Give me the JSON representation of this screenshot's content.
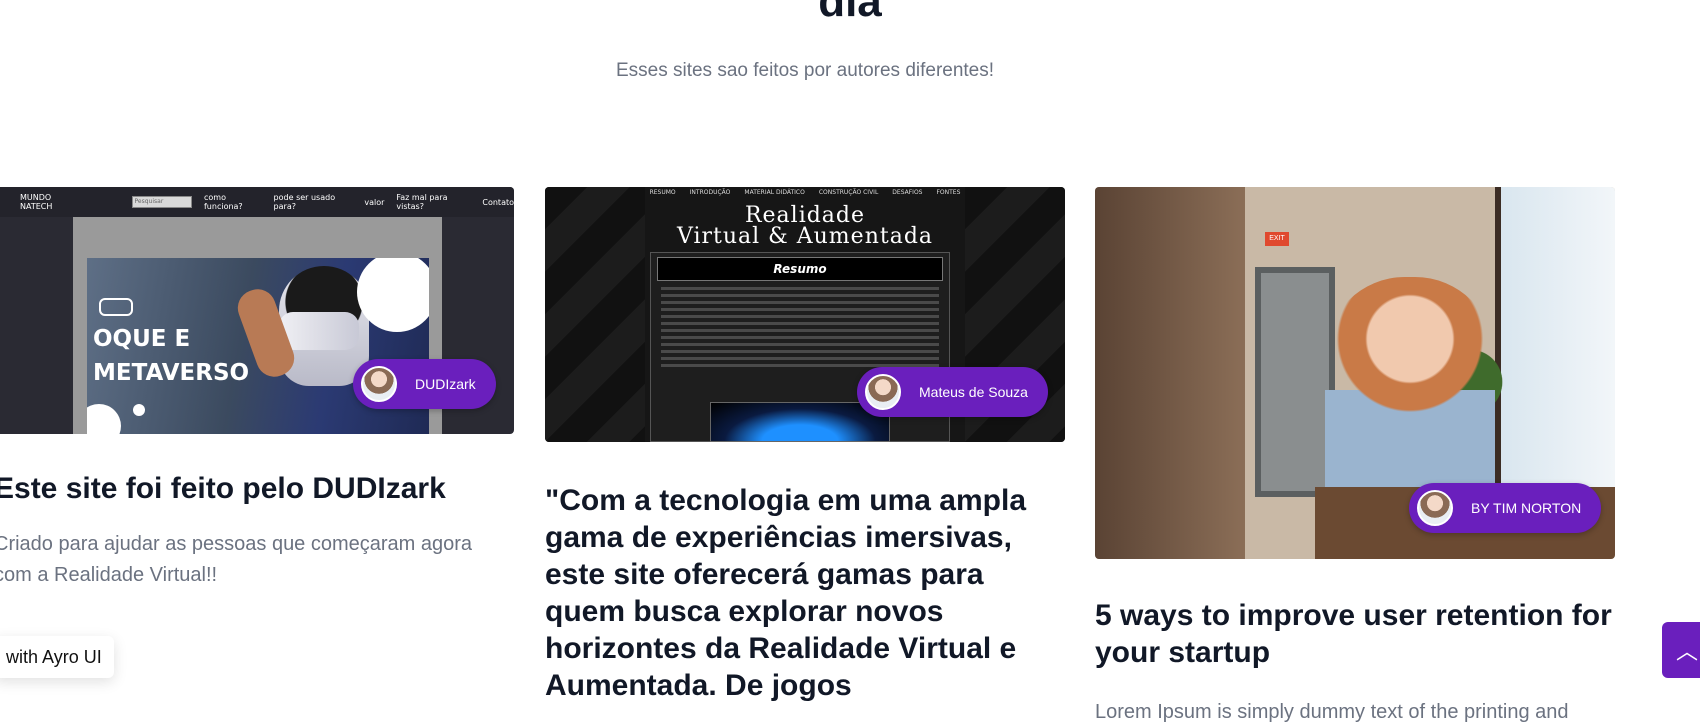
{
  "section": {
    "title": "dia",
    "subtitle": "Esses sites sao feitos por autores diferentes!"
  },
  "cards": [
    {
      "author": "DUDIzark",
      "title": "Este site foi feito pelo DUDIzark",
      "text": "Criado para ajudar as pessoas que começaram agora com a Realidade Virtual!!",
      "preview": {
        "nav_brand": "MUNDO NATECH",
        "search_placeholder": "Pesquisar",
        "nav_links": [
          "como funciona?",
          "pode ser usado para?",
          "valor",
          "Faz mal para vistas?",
          "Contato"
        ],
        "hero_text_line1": "OQUE E",
        "hero_text_line2": "METAVERSO"
      }
    },
    {
      "author": "Mateus de Souza",
      "title": "\"Com a tecnologia em uma ampla gama de experiências imersivas, este site oferecerá gamas para quem busca explorar novos horizontes da Realidade Virtual e Aumentada. De jogos",
      "preview": {
        "nav_links": [
          "RESUMO",
          "INTRODUÇÃO",
          "MATERIAL DIDÁTICO",
          "CONSTRUÇÃO CIVIL",
          "DESAFIOS",
          "FONTES"
        ],
        "title_line1": "Realidade",
        "title_line2": "Virtual & Aumentada",
        "box_heading": "Resumo"
      }
    },
    {
      "author": "BY TIM NORTON",
      "title": "5 ways to improve user retention for your startup",
      "text": "Lorem Ipsum is simply dummy text of the printing and",
      "preview": {
        "sign_text": "EXIT"
      }
    }
  ],
  "badge": {
    "label": "with Ayro UI"
  },
  "scroll_top": {
    "icon": "chevron-up-icon",
    "glyph": "︿"
  },
  "colors": {
    "accent": "#6a1fbd"
  }
}
